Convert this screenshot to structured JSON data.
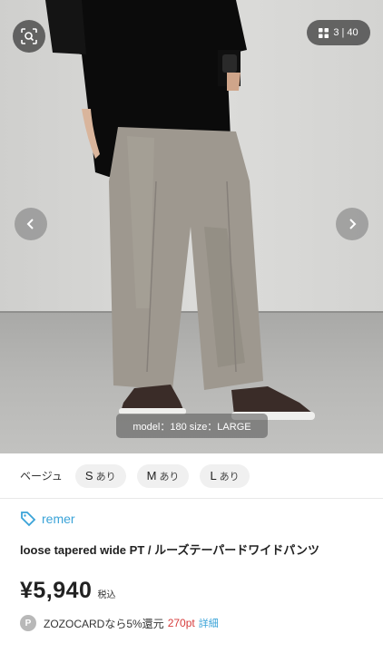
{
  "gallery": {
    "counter": "3 | 40",
    "caption": "model：180 size：LARGE"
  },
  "sizes": {
    "label": "ベージュ",
    "items": [
      {
        "size": "S",
        "stock": "あり"
      },
      {
        "size": "M",
        "stock": "あり"
      },
      {
        "size": "L",
        "stock": "あり"
      }
    ]
  },
  "product": {
    "brand": "remer",
    "title": "loose tapered wide PT / ルーズテーパードワイドパンツ",
    "price": "¥5,940",
    "tax_label": "税込"
  },
  "points": {
    "badge": "P",
    "text": "ZOZOCARDなら5%還元",
    "amount": "270pt",
    "details_link": "詳細"
  },
  "colors": {
    "brand_link": "#3aa3d8",
    "points_red": "#d63b3b"
  }
}
